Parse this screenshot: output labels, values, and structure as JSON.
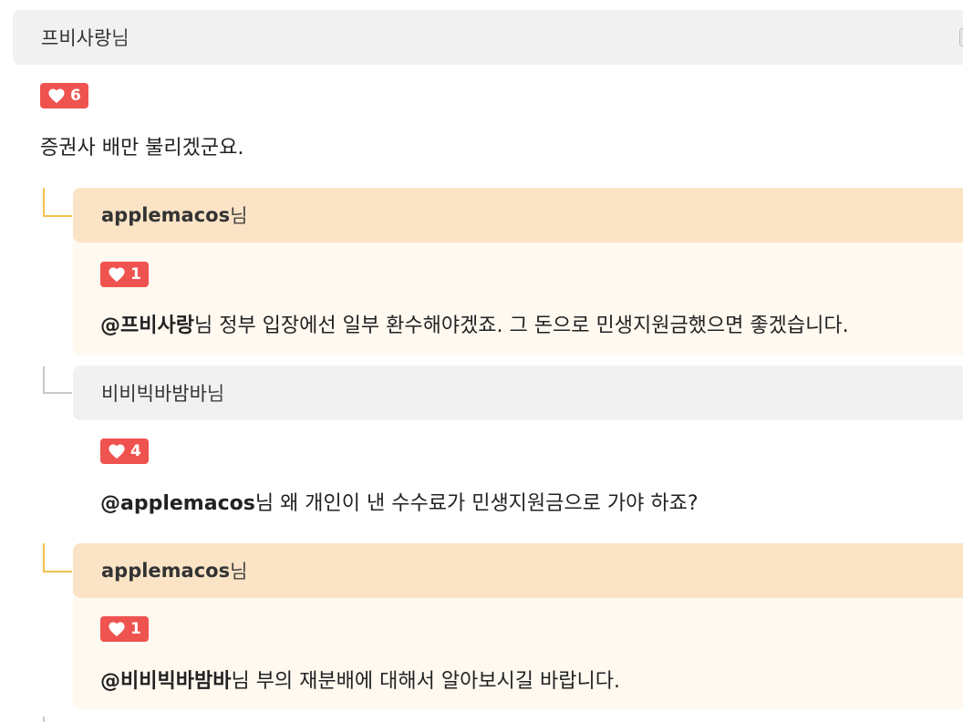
{
  "root": {
    "author": "프비사랑",
    "author_suffix": "님",
    "tag": "LI",
    "likes": "6",
    "text": "증권사 배만 불리겠군요."
  },
  "replies": [
    {
      "author": "applemacos",
      "author_suffix": "님",
      "likes": "1",
      "mention": "@프비사랑",
      "mention_suffix": "님",
      "text": " 정부 입장에선 일부 환수해야겠죠. 그 돈으로 민생지원금했으면 좋겠습니다."
    },
    {
      "author": "비비빅바밤바",
      "author_suffix": "님",
      "likes": "4",
      "mention": "@applemacos",
      "mention_suffix": "님",
      "text": " 왜 개인이 낸 수수료가 민생지원금으로 가야 하죠?"
    },
    {
      "author": "applemacos",
      "author_suffix": "님",
      "likes": "1",
      "mention": "@비비빅바밤바",
      "mention_suffix": "님",
      "text": " 부의 재분배에 대해서 알아보시길 바랍니다."
    }
  ],
  "colors": {
    "like_badge": "#ef5350",
    "orange_header": "#fbe4c6",
    "gray_header": "#f1f1f1",
    "orange_connector": "#f2c14e",
    "gray_connector": "#c8c8c8"
  },
  "icons": {
    "like": "heart-icon"
  }
}
